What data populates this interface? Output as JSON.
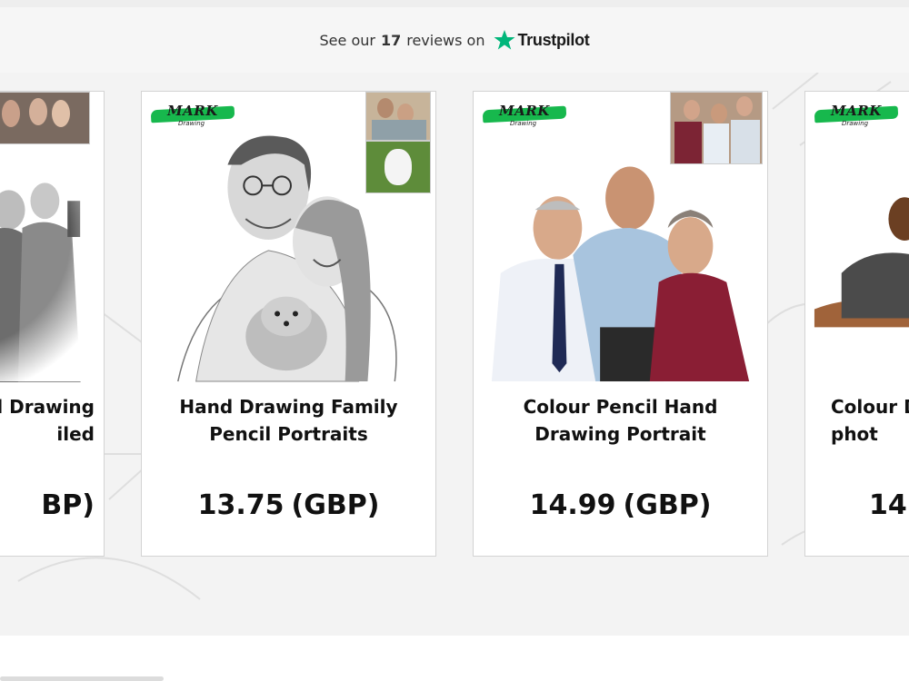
{
  "trustbar": {
    "prefix": "See our",
    "count": "17",
    "suffix": "reviews on",
    "brand": "Trustpilot",
    "star_color": "#00b67a"
  },
  "logo": {
    "text": "MARK",
    "subtext": "Drawing",
    "accent": "#17b84d"
  },
  "products": [
    {
      "title": "d Drawing\niled",
      "price": "",
      "currency": "BP)"
    },
    {
      "title": "Hand Drawing Family Pencil Portraits",
      "price": "13.75",
      "currency": "(GBP)"
    },
    {
      "title": "Colour Pencil Hand Drawing Portrait",
      "price": "14.99",
      "currency": "(GBP)"
    },
    {
      "title": "Colour D\nphot",
      "price": "14.",
      "currency": ""
    }
  ],
  "icons": [
    "trustpilot-star-icon"
  ]
}
